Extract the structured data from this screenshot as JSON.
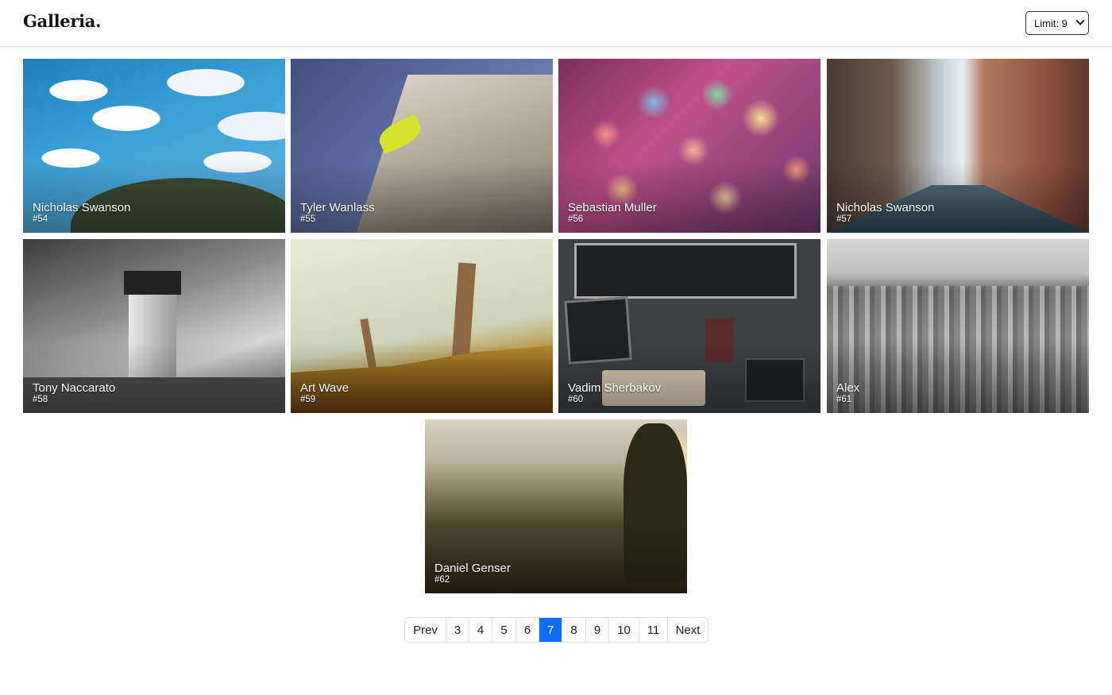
{
  "app": {
    "title": "Galleria."
  },
  "limit": {
    "label": "Limit: 9"
  },
  "photos": [
    {
      "author": "Nicholas Swanson",
      "id": "#54"
    },
    {
      "author": "Tyler Wanlass",
      "id": "#55"
    },
    {
      "author": "Sebastian Muller",
      "id": "#56"
    },
    {
      "author": "Nicholas Swanson",
      "id": "#57"
    },
    {
      "author": "Tony Naccarato",
      "id": "#58"
    },
    {
      "author": "Art Wave",
      "id": "#59"
    },
    {
      "author": "Vadim Sherbakov",
      "id": "#60"
    },
    {
      "author": "Alex",
      "id": "#61"
    },
    {
      "author": "Daniel Genser",
      "id": "#62"
    }
  ],
  "pagination": {
    "prev": "Prev",
    "next": "Next",
    "pages": [
      "3",
      "4",
      "5",
      "6",
      "7",
      "8",
      "9",
      "10",
      "11"
    ],
    "current": "7"
  },
  "colors": {
    "accent": "#0d6efd"
  }
}
